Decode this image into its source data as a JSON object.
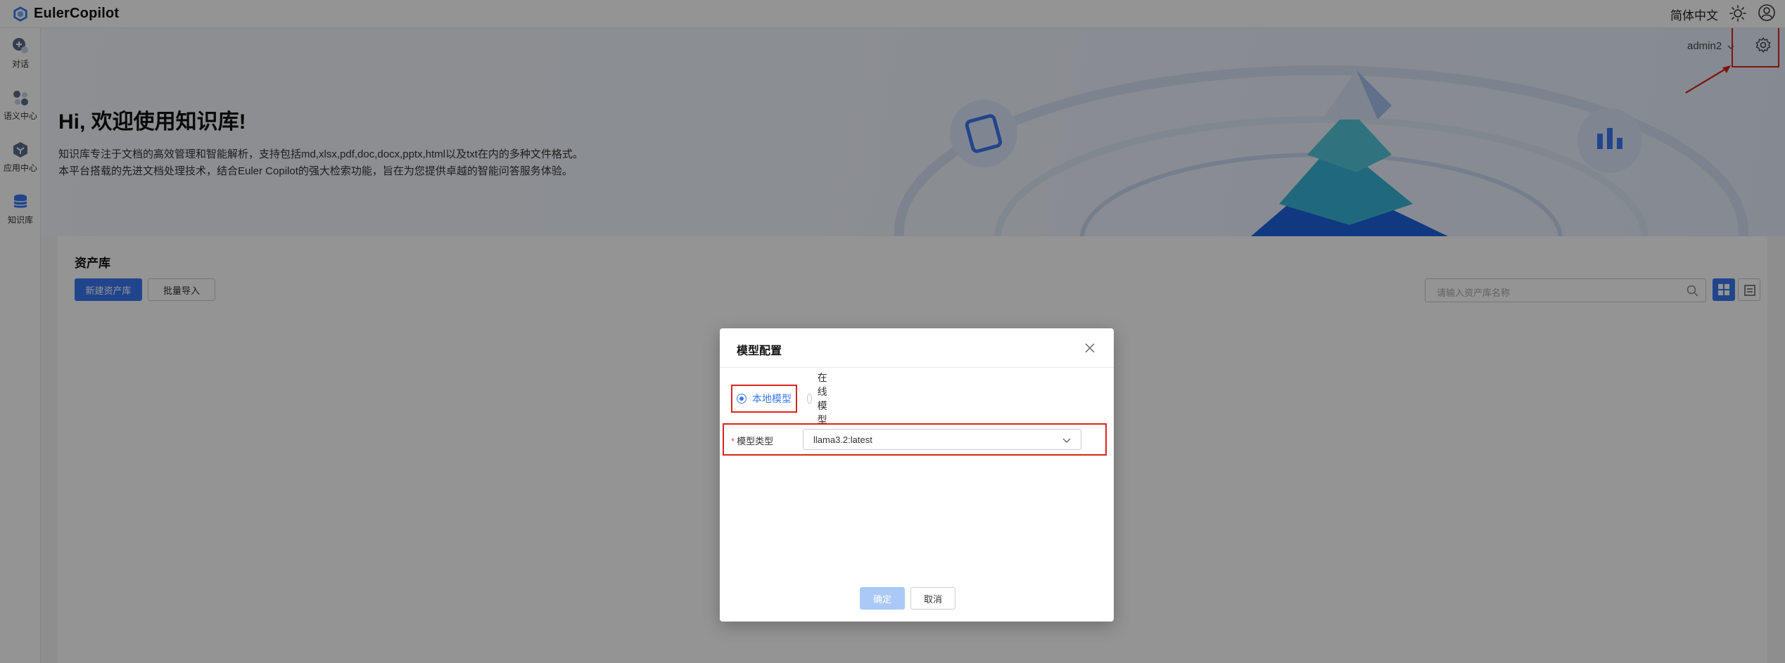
{
  "app": {
    "name": "EulerCopilot",
    "language": "简体中文"
  },
  "sidebar": {
    "items": [
      {
        "label": "对话",
        "icon": "chat-plus-icon"
      },
      {
        "label": "语义中心",
        "icon": "semantic-hub-icon"
      },
      {
        "label": "应用中心",
        "icon": "app-center-icon"
      },
      {
        "label": "知识库",
        "icon": "database-icon"
      }
    ]
  },
  "hero": {
    "title": "Hi, 欢迎使用知识库!",
    "line1": "知识库专注于文档的高效管理和智能解析，支持包括md,xlsx,pdf,doc,docx,pptx,html以及txt在内的多种文件格式。",
    "line2": "本平台搭载的先进文档处理技术，结合Euler Copilot的强大检索功能，旨在为您提供卓越的智能问答服务体验。",
    "user": "admin2"
  },
  "asset": {
    "title": "资产库",
    "new_button": "新建资产库",
    "batch_import_button": "批量导入",
    "search_placeholder": "请输入资产库名称"
  },
  "modal": {
    "title": "模型配置",
    "radio_local": "本地模型",
    "radio_online": "在线模型",
    "selected": "本地模型",
    "model_type_label": "模型类型",
    "model_type_value": "llama3.2:latest",
    "ok": "确定",
    "cancel": "取消"
  },
  "colors": {
    "accent": "#3a78f2",
    "annotation": "#d9251c",
    "disabled_primary": "#aac9f7"
  }
}
